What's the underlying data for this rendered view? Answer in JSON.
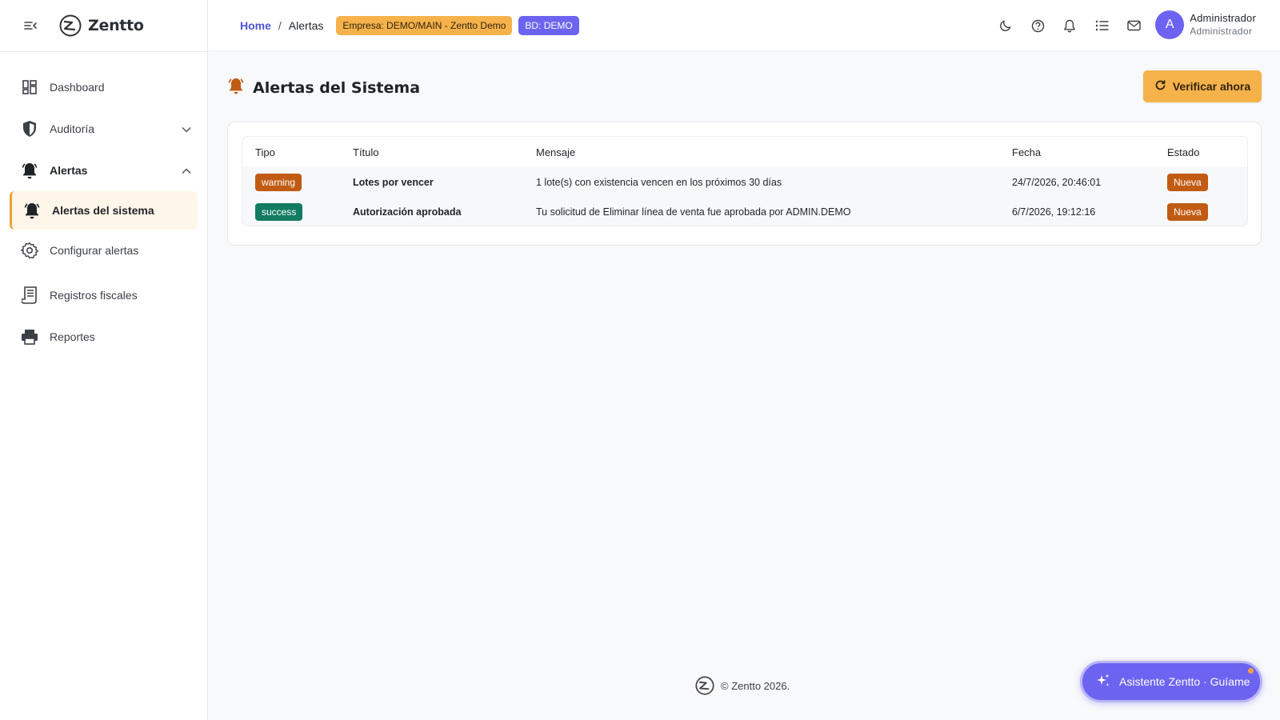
{
  "brand": {
    "name": "Zentto"
  },
  "sidebar": {
    "items": [
      {
        "label": "Dashboard"
      },
      {
        "label": "Auditoría"
      },
      {
        "label": "Alertas"
      },
      {
        "label": "Alertas del sistema"
      },
      {
        "label": "Configurar alertas"
      },
      {
        "label": "Registros fiscales"
      },
      {
        "label": "Reportes"
      }
    ]
  },
  "topbar": {
    "breadcrumb": {
      "home": "Home",
      "separator": "/",
      "current": "Alertas"
    },
    "company_chip": "Empresa: DEMO/MAIN - Zentto Demo",
    "db_chip": "BD: DEMO",
    "icons": [
      "moon-icon",
      "help-icon",
      "bell-icon",
      "list-icon",
      "mail-icon"
    ],
    "user": {
      "initial": "A",
      "name": "Administrador",
      "role": "Administrador"
    }
  },
  "page": {
    "title": "Alertas del Sistema",
    "verify_button": "Verificar ahora"
  },
  "table": {
    "headers": [
      "Tipo",
      "Título",
      "Mensaje",
      "Fecha",
      "Estado"
    ],
    "rows": [
      {
        "tipo": "warning",
        "titulo": "Lotes por vencer",
        "mensaje": "1 lote(s) con existencia vencen en los próximos 30 días",
        "fecha": "24/7/2026, 20:46:01",
        "estado": "Nueva"
      },
      {
        "tipo": "success",
        "titulo": "Autorización aprobada",
        "mensaje": "Tu solicitud de Eliminar línea de venta fue aprobada por ADMIN.DEMO",
        "fecha": "6/7/2026, 19:12:16",
        "estado": "Nueva"
      }
    ]
  },
  "footer": {
    "text": "© Zentto 2026."
  },
  "assistant": {
    "label": "Asistente Zentto · Guíame"
  },
  "colors": {
    "accent": "#6c63f0",
    "warning": "#f6b24a",
    "badge_warning": "#c15b14",
    "badge_success": "#127c62"
  }
}
